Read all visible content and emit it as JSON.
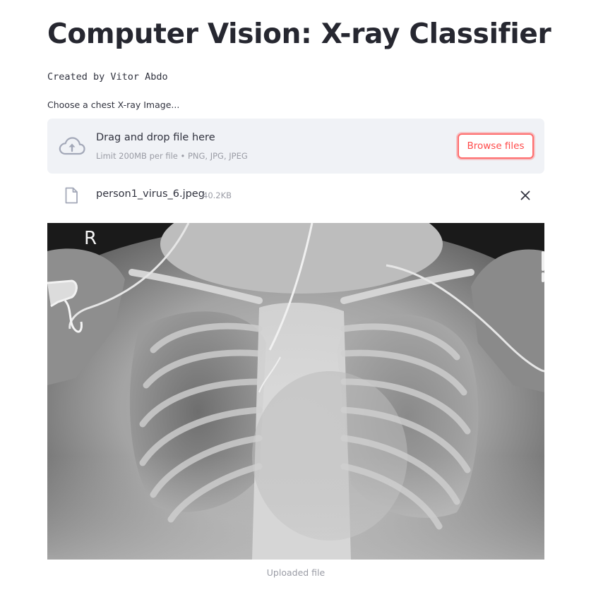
{
  "header": {
    "title": "Computer Vision: X-ray Classifier",
    "author": "Created by Vitor Abdo"
  },
  "uploader": {
    "label": "Choose a chest X-ray Image...",
    "dropzone_title": "Drag and drop file here",
    "dropzone_limits": "Limit 200MB per file • PNG, JPG, JPEG",
    "browse_label": "Browse files",
    "upload_icon": "cloud-upload-icon",
    "file_icon": "file-icon",
    "remove_icon": "close-icon"
  },
  "uploaded_file": {
    "name": "person1_virus_6.jpeg",
    "size": "40.2KB"
  },
  "image": {
    "marker": "R",
    "caption": "Uploaded file"
  },
  "colors": {
    "accent": "#ff4b4b",
    "dropzone_bg": "#f0f2f6",
    "text": "#31333f",
    "muted": "#9a9ca5"
  }
}
